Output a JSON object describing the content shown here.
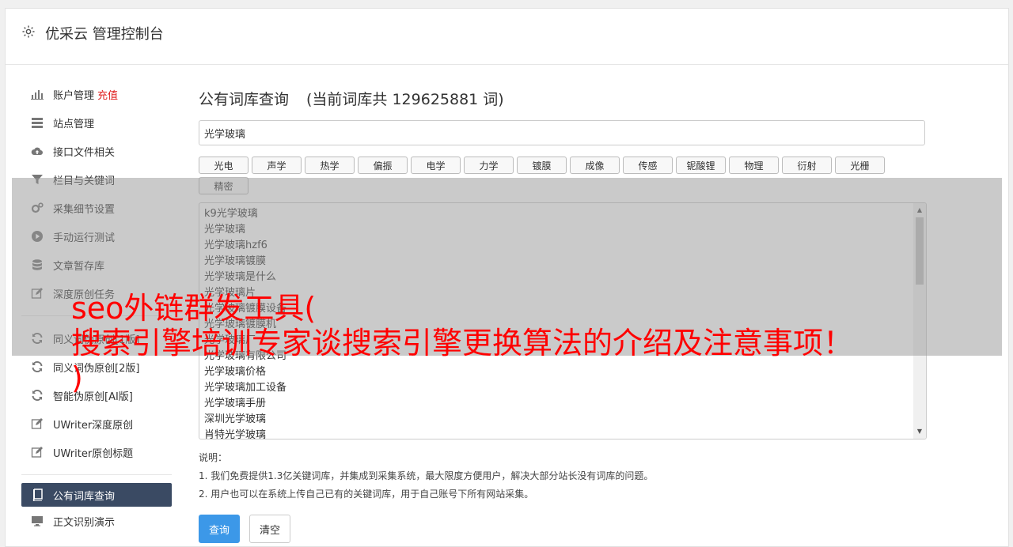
{
  "header": {
    "title": "优采云 管理控制台",
    "icon": "gear-icon"
  },
  "sidebar": {
    "items": [
      {
        "label": "账户管理",
        "badge": "充值",
        "icon": "bar-chart-icon"
      },
      {
        "label": "站点管理",
        "icon": "server-icon"
      },
      {
        "label": "接口文件相关",
        "icon": "cloud-upload-icon"
      },
      {
        "label": "栏目与关键词",
        "icon": "filter-icon"
      },
      {
        "label": "采集细节设置",
        "icon": "gears-icon"
      },
      {
        "label": "手动运行测试",
        "icon": "play-circle-icon"
      },
      {
        "label": "文章暂存库",
        "icon": "database-icon"
      },
      {
        "label": "深度原创任务",
        "icon": "edit-icon"
      }
    ],
    "items2": [
      {
        "label": "同义词伪原创[1版]",
        "icon": "refresh-icon"
      },
      {
        "label": "同义词伪原创[2版]",
        "icon": "refresh-icon"
      },
      {
        "label": "智能伪原创[AI版]",
        "icon": "refresh-icon"
      },
      {
        "label": "UWriter深度原创",
        "icon": "edit-icon"
      },
      {
        "label": "UWriter原创标题",
        "icon": "edit-icon"
      }
    ],
    "items3": [
      {
        "label": "公有词库查询",
        "icon": "book-icon",
        "active": true
      },
      {
        "label": "正文识别演示",
        "icon": "monitor-icon"
      }
    ]
  },
  "main": {
    "title": "公有词库查询",
    "count_text": "(当前词库共 129625881 词)",
    "search_value": "光学玻璃",
    "tags": [
      "光电",
      "声学",
      "热学",
      "偏振",
      "电学",
      "力学",
      "镀膜",
      "成像",
      "传感",
      "铌酸锂",
      "物理",
      "衍射",
      "光栅",
      "精密"
    ],
    "results": [
      "k9光学玻璃",
      "光学玻璃",
      "光学玻璃hzf6",
      "光学玻璃镀膜",
      "光学玻璃是什么",
      "光学玻璃片",
      "光学玻璃镀膜设备",
      "光学玻璃镀膜机",
      "光学玻璃厂",
      "光学玻璃有限公司",
      "光学玻璃价格",
      "光学玻璃加工设备",
      "光学玻璃手册",
      "深圳光学玻璃",
      "肖特光学玻璃"
    ],
    "notes_title": "说明：",
    "notes": [
      "1. 我们免费提供1.3亿关键词库，并集成到采集系统，最大限度方便用户，解决大部分站长没有词库的问题。",
      "2. 用户也可以在系统上传自己已有的关键词库，用于自己账号下所有网站采集。"
    ],
    "query_label": "查询",
    "clear_label": "清空"
  },
  "banner": {
    "line1": "seo外链群发工具(",
    "line2": "搜索引擎培训专家谈搜索引擎更换算法的介绍及注意事项！",
    "line3": ")"
  },
  "colors": {
    "accent": "#3c98e8",
    "active_nav": "#3a4a63",
    "badge": "#e02020",
    "banner": "#ff0000"
  }
}
